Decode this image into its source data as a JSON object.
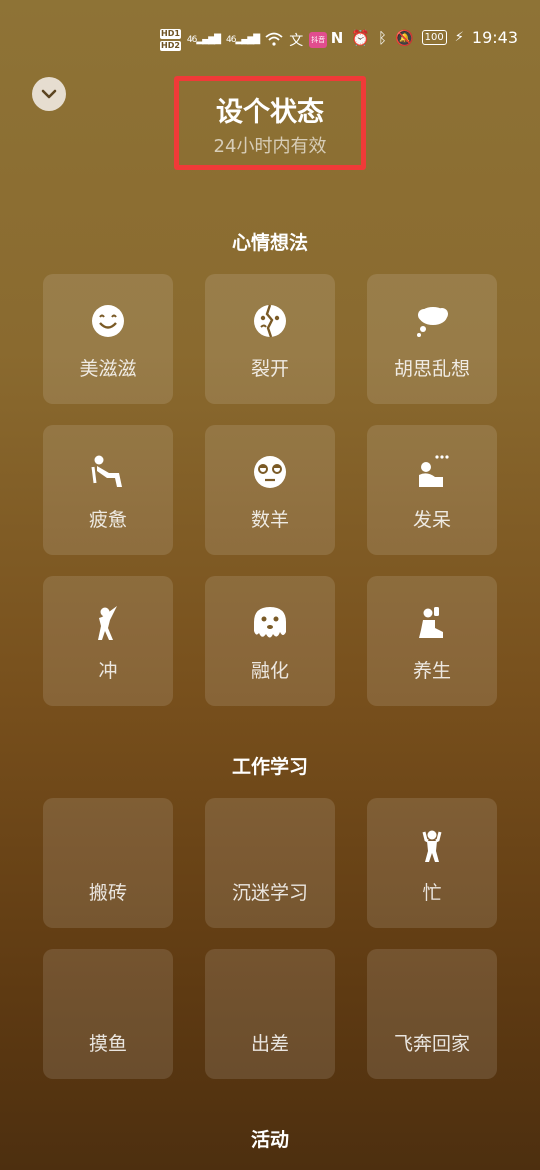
{
  "status_bar": {
    "hd1": "HD1",
    "hd2": "HD2",
    "sig1": "46",
    "sig2": "46",
    "app_badge": "抖音",
    "battery": "100",
    "time": "19:43"
  },
  "header": {
    "title": "设个状态",
    "subtitle": "24小时内有效"
  },
  "sections": [
    {
      "title": "心情想法",
      "items": [
        {
          "label": "美滋滋",
          "icon": "smile-icon"
        },
        {
          "label": "裂开",
          "icon": "cracked-face-icon"
        },
        {
          "label": "胡思乱想",
          "icon": "thought-cloud-icon"
        },
        {
          "label": "疲惫",
          "icon": "tired-person-icon"
        },
        {
          "label": "数羊",
          "icon": "sleepy-face-icon"
        },
        {
          "label": "发呆",
          "icon": "daze-person-icon"
        },
        {
          "label": "冲",
          "icon": "charge-person-icon"
        },
        {
          "label": "融化",
          "icon": "melting-face-icon"
        },
        {
          "label": "养生",
          "icon": "meditate-person-icon"
        }
      ]
    },
    {
      "title": "工作学习",
      "items": [
        {
          "label": "搬砖",
          "icon": ""
        },
        {
          "label": "沉迷学习",
          "icon": ""
        },
        {
          "label": "忙",
          "icon": "busy-person-icon"
        },
        {
          "label": "摸鱼",
          "icon": ""
        },
        {
          "label": "出差",
          "icon": ""
        },
        {
          "label": "飞奔回家",
          "icon": ""
        }
      ]
    },
    {
      "title": "活动",
      "items": []
    }
  ],
  "colors": {
    "highlight_box": "#f03a38",
    "tile_bg": "rgba(255,255,255,0.12)"
  }
}
